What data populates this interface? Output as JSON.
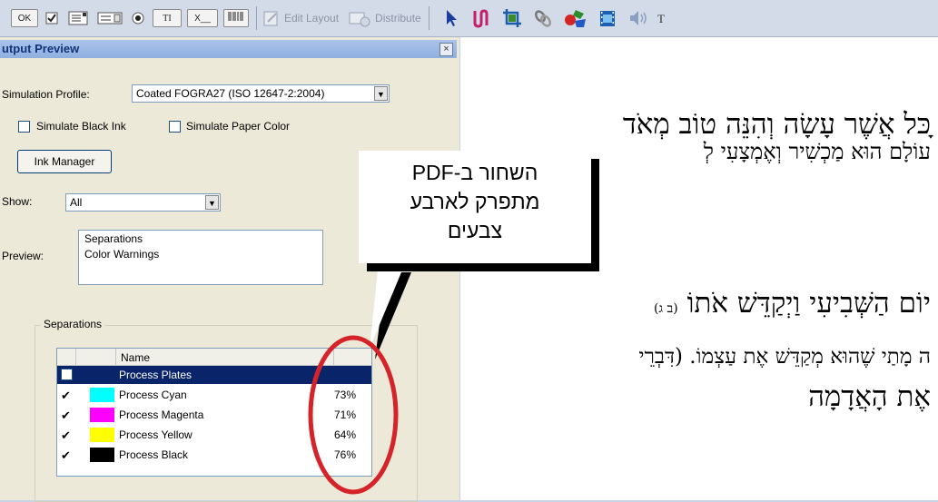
{
  "toolbar": {
    "ok_label": "OK",
    "text_field_label": "TI",
    "combo_label": "X__",
    "barcode_label": "0123",
    "edit_layout": "Edit Layout",
    "distribute": "Distribute"
  },
  "panel": {
    "title": "utput Preview",
    "close": "×",
    "simulation_profile_label": "Simulation Profile:",
    "simulation_profile_value": "Coated FOGRA27 (ISO 12647-2:2004)",
    "simulate_black_ink": "Simulate Black Ink",
    "simulate_paper_color": "Simulate Paper Color",
    "ink_manager": "Ink Manager",
    "show_label": "Show:",
    "show_value": "All",
    "preview_label": "Preview:",
    "preview_options": [
      "Separations",
      "Color Warnings"
    ],
    "separations_group": "Separations",
    "name_header": "Name",
    "rows": [
      {
        "name": "Process Plates",
        "pct": "",
        "color": ""
      },
      {
        "name": "Process Cyan",
        "pct": "73%",
        "color": "#00ffff"
      },
      {
        "name": "Process Magenta",
        "pct": "71%",
        "color": "#ff00ff"
      },
      {
        "name": "Process Yellow",
        "pct": "64%",
        "color": "#ffff00"
      },
      {
        "name": "Process Black",
        "pct": "76%",
        "color": "#000000"
      }
    ]
  },
  "document": {
    "line1": "ָכּל אֲשֶׁר עָשָׂה וְהִנֵּה טוֹב מְאֹד",
    "line2": "עוֹלָם הוּא מַכְשִׁיר וְאֶמְצָעִי לְ",
    "line3": "יוֹם הַשְּׁבִיעִי וַיְקַדֵּשׁ אֹתוֹ",
    "line3_ref": "(ב ג)",
    "line4": "ה מָתַי שֶׁהוּא מְקַדֵּשׁ אֶת עַצְמוֹ. (דִּבְרֵי",
    "line5": "אֶת הָאֲדָמָה"
  },
  "callout": {
    "line1": "השחור ב-PDF",
    "line2": "מתפרק לארבע",
    "line3": "צבעים"
  },
  "colors": {
    "highlight_circle": "#d4242a",
    "selection": "#0a246a"
  }
}
